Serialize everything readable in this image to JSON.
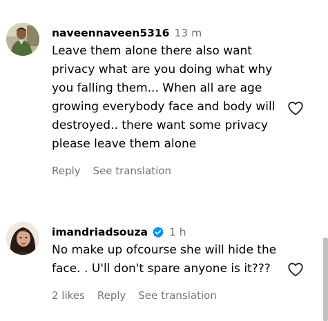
{
  "comments": [
    {
      "username": "naveennaveen5316",
      "time": "13 m",
      "verified": false,
      "text": "Leave them alone there also want privacy what are you doing what why you falling them... When all are age growing everybody face and body will destroyed.. there want some privacy please leave them alone",
      "actions": {
        "likes": "",
        "reply": "Reply",
        "see_translation": "See translation"
      },
      "avatar_icon": "man-in-green-shirt-avatar",
      "like_icon": "heart-outline-icon"
    },
    {
      "username": "imandriadsouza",
      "time": "1 h",
      "verified": true,
      "text": "No make up ofcourse she will hide the face. . U'll don't spare anyone is it???",
      "actions": {
        "likes": "2 likes",
        "reply": "Reply",
        "see_translation": "See translation"
      },
      "avatar_icon": "woman-portrait-avatar",
      "like_icon": "heart-outline-icon"
    }
  ],
  "colors": {
    "text": "#000000",
    "secondary": "#737373",
    "verified": "#0095f6",
    "background": "#ffffff"
  }
}
